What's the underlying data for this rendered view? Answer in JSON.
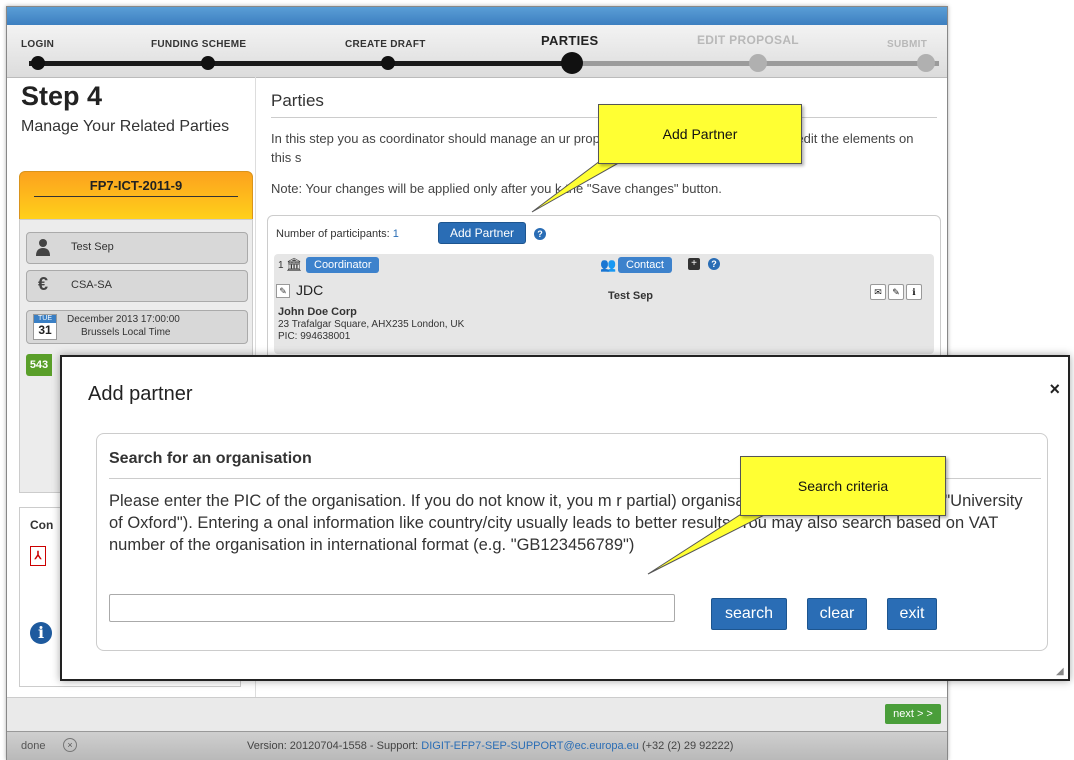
{
  "stepper": {
    "steps": [
      {
        "label": "LOGIN"
      },
      {
        "label": "FUNDING SCHEME"
      },
      {
        "label": "CREATE DRAFT"
      },
      {
        "label": "PARTIES"
      },
      {
        "label": "EDIT PROPOSAL"
      },
      {
        "label": "SUBMIT"
      }
    ],
    "current": "PARTIES"
  },
  "sidebar": {
    "step_title": "Step 4",
    "step_subtitle": "Manage Your Related Parties",
    "call_code": "FP7-ICT-2011-9",
    "items": [
      {
        "icon": "person-icon",
        "label": "Test Sep"
      },
      {
        "icon": "euro-icon",
        "label": "CSA-SA"
      },
      {
        "icon": "calendar-icon",
        "cal_month": "TUE",
        "cal_day": "31",
        "label": "December 2013 17:00:00",
        "sublabel": "Brussels Local Time"
      }
    ],
    "badge": "543",
    "contact_label": "Con"
  },
  "main": {
    "heading": "Parties",
    "paragraph1": "In this step you as coordinator should manage an                                                 ur proposal. Only you as coordinator can edit the elements on this s",
    "paragraph2": "Note: Your changes will be applied only after you       k the \"Save changes\" button.",
    "participants_label": "Number of participants:",
    "participants_count": "1",
    "add_partner_button": "Add Partner",
    "coordinator": {
      "index": "1",
      "role_tag": "Coordinator",
      "short_name": "JDC",
      "legal_name": "John Doe Corp",
      "address": "23 Trafalgar Square, AHX235 London, UK",
      "pic": "PIC: 994638001"
    },
    "contact": {
      "tag": "Contact",
      "name": "Test Sep"
    }
  },
  "footer": {
    "next_button": "next > >",
    "status_done": "done",
    "version_text": "Version: 20120704-1558 - Support: ",
    "support_email": "DIGIT-EFP7-SEP-SUPPORT@ec.europa.eu",
    "phone": " (+32 (2) 29 92222)"
  },
  "callouts": {
    "add_partner": "Add Partner",
    "search_criteria": "Search criteria"
  },
  "modal": {
    "title": "Add partner",
    "close": "×",
    "section_title": "Search for an organisation",
    "description": "Please enter the PIC of the organisation. If you do not know it, you m                                      r partial) organisation name (e.g. \"Oxford\" or \"University of Oxford\"). Entering a          onal information like country/city usually leads to better results. You may also search       based on VAT number of the organisation in international format (e.g. \"GB123456789\")",
    "search_value": "",
    "search_placeholder": "",
    "buttons": {
      "search": "search",
      "clear": "clear",
      "exit": "exit"
    }
  },
  "colors": {
    "accent_blue": "#2a6db5",
    "callout_yellow": "#ffff33",
    "call_orange": "#fca21e",
    "next_green": "#4a9e3a"
  }
}
